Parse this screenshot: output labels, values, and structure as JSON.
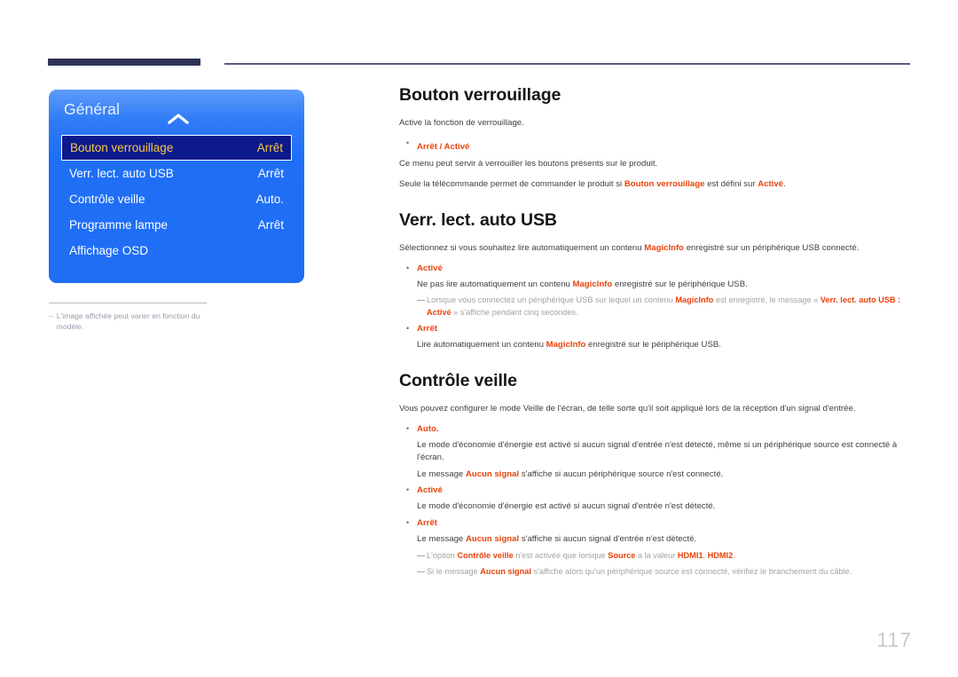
{
  "page": {
    "number": "117"
  },
  "osd": {
    "title": "Général",
    "chevron": "chevron-up-icon",
    "items": [
      {
        "label": "Bouton verrouillage",
        "value": "Arrêt",
        "selected": true
      },
      {
        "label": "Verr. lect. auto USB",
        "value": "Arrêt",
        "selected": false
      },
      {
        "label": "Contrôle veille",
        "value": "Auto.",
        "selected": false
      },
      {
        "label": "Programme lampe",
        "value": "Arrêt",
        "selected": false
      },
      {
        "label": "Affichage OSD",
        "value": "",
        "selected": false
      }
    ]
  },
  "left_note": {
    "dash": "–",
    "text": "L'image affichée peut varier en fonction du modèle."
  },
  "sections": [
    {
      "title": "Bouton verrouillage",
      "intro": "Active la fonction de verrouillage."
    },
    {
      "title": "Verr. lect. auto USB"
    },
    {
      "title": "Contrôle veille"
    }
  ],
  "s1": {
    "title": "Bouton verrouillage",
    "intro": "Active la fonction de verrouillage.",
    "bullet_1": "Arrêt / Activé",
    "line_1": "Ce menu peut servir à verrouiller les boutons présents sur le produit.",
    "line_2_a": "Seule la télécommande permet de commander le produit si ",
    "line_2_em1": "Bouton verrouillage",
    "line_2_b": " est défini sur ",
    "line_2_em2": "Activé",
    "line_2_c": "."
  },
  "s2": {
    "title": "Verr. lect. auto USB",
    "intro_a": "Sélectionnez si vous souhaitez lire automatiquement un contenu ",
    "intro_em": "MagicInfo",
    "intro_b": " enregistré sur un périphérique USB connecté.",
    "b1_head": "Activé",
    "b1_sub_a": "Ne pas lire automatiquement un contenu ",
    "b1_sub_em": "MagicInfo",
    "b1_sub_b": " enregistré sur le périphérique USB.",
    "note_dash": "—",
    "note_a": "Lorsque vous connectez un périphérique USB sur lequel un contenu ",
    "note_em1": "MagicInfo",
    "note_b": " est enregistré, le message « ",
    "note_em2": "Verr. lect. auto USB : Activé",
    "note_c": " » s'affiche pendant cinq secondes.",
    "b2_head": "Arrêt",
    "b2_sub_a": "Lire automatiquement un contenu ",
    "b2_sub_em": "MagicInfo",
    "b2_sub_b": " enregistré sur le périphérique USB."
  },
  "s3": {
    "title": "Contrôle veille",
    "intro": "Vous pouvez configurer le mode Veille de l'écran, de telle sorte qu'il soit appliqué lors de la réception d'un signal d'entrée.",
    "b1_head": "Auto.",
    "b1_sub1": "Le mode d'économie d'énergie est activé si aucun signal d'entrée n'est détecté, même si un périphérique source est connecté à l'écran.",
    "b1_sub2_a": "Le message ",
    "b1_sub2_em": "Aucun signal",
    "b1_sub2_b": " s'affiche si aucun périphérique source n'est connecté.",
    "b2_head": "Activé",
    "b2_sub": "Le mode d'économie d'énergie est activé si aucun signal d'entrée n'est détecté.",
    "b3_head": "Arrêt",
    "b3_sub_a": "Le message ",
    "b3_sub_em": "Aucun signal",
    "b3_sub_b": " s'affiche si aucun signal d'entrée n'est détecté.",
    "note1_dash": "—",
    "note1_a": "L'option ",
    "note1_em1": "Contrôle veille",
    "note1_b": " n'est activée que lorsque ",
    "note1_em2": "Source",
    "note1_c": " a la valeur ",
    "note1_em3": "HDMI1",
    "note1_d": ", ",
    "note1_em4": "HDMI2",
    "note1_e": ".",
    "note2_dash": "—",
    "note2_a": "Si le message ",
    "note2_em": "Aucun signal",
    "note2_b": " s'affiche alors qu'un périphérique source est connecté, vérifiez le branchement du câble."
  },
  "colors": {
    "accent_red": "#e8430c",
    "osd_blue": "#1f6df5",
    "osd_selected_bg": "#0d1a8c",
    "osd_selected_text": "#f5c842",
    "rule_dark": "#2e3355",
    "page_num": "#c9c9cf"
  }
}
